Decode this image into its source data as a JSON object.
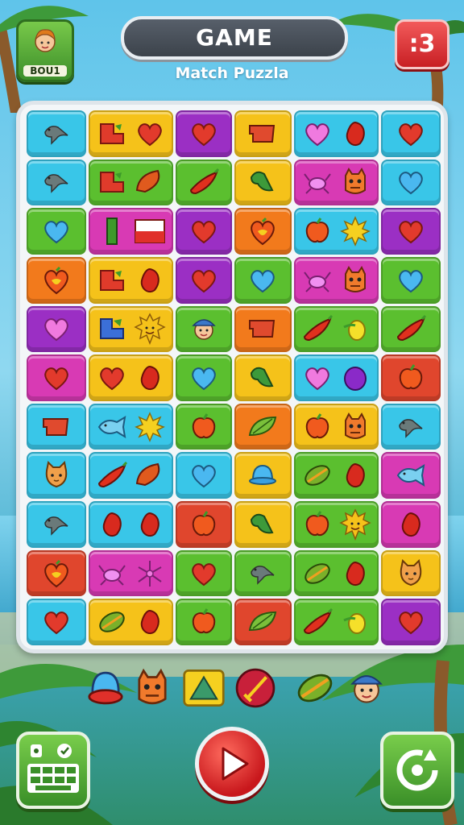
{
  "header": {
    "avatar_label": "BOU1",
    "title": "GAME",
    "subtitle": "Match Puzzla",
    "count_badge": ":3"
  },
  "colors": {
    "cyan": "#39c6e8",
    "yellow": "#f5c21a",
    "purple": "#9b2fc4",
    "orange": "#f27a1c",
    "green": "#5bbf2f",
    "magenta": "#d83ab4",
    "red": "#e0462d"
  },
  "board": {
    "columns": 6,
    "rows": 11,
    "tiles": [
      [
        {
          "c": "cyan",
          "i": [
            "bird"
          ]
        },
        {
          "c": "yellow",
          "i": [
            "block",
            "heart"
          ]
        },
        {
          "c": "purple",
          "i": [
            "heart"
          ]
        },
        {
          "c": "yellow",
          "i": [
            "flag"
          ]
        },
        {
          "c": "cyan",
          "i": [
            "heart-pink",
            "berry"
          ]
        },
        {
          "c": "cyan",
          "i": [
            "heart"
          ]
        }
      ],
      [
        {
          "c": "cyan",
          "i": [
            "bird"
          ]
        },
        {
          "c": "green",
          "i": [
            "block",
            "leaf-red"
          ]
        },
        {
          "c": "green",
          "i": [
            "pepper"
          ]
        },
        {
          "c": "yellow",
          "i": [
            "leaf"
          ]
        },
        {
          "c": "magenta",
          "i": [
            "crab",
            "monster"
          ]
        },
        {
          "c": "cyan",
          "i": [
            "heart-blue"
          ]
        }
      ],
      [
        {
          "c": "green",
          "i": [
            "heart-blue"
          ]
        },
        {
          "c": "magenta",
          "i": [
            "bar",
            "card"
          ]
        },
        {
          "c": "purple",
          "i": [
            "heart"
          ]
        },
        {
          "c": "orange",
          "i": [
            "fruit-heart"
          ]
        },
        {
          "c": "cyan",
          "i": [
            "apple",
            "sun"
          ]
        },
        {
          "c": "purple",
          "i": [
            "heart"
          ]
        }
      ],
      [
        {
          "c": "orange",
          "i": [
            "fruit-heart"
          ]
        },
        {
          "c": "yellow",
          "i": [
            "block",
            "berry"
          ]
        },
        {
          "c": "purple",
          "i": [
            "heart"
          ]
        },
        {
          "c": "green",
          "i": [
            "heart-blue"
          ]
        },
        {
          "c": "magenta",
          "i": [
            "crab",
            "monster"
          ]
        },
        {
          "c": "green",
          "i": [
            "heart-blue"
          ]
        }
      ],
      [
        {
          "c": "purple",
          "i": [
            "heart-pink"
          ]
        },
        {
          "c": "yellow",
          "i": [
            "block-blue",
            "sun-face"
          ]
        },
        {
          "c": "green",
          "i": [
            "boy"
          ]
        },
        {
          "c": "orange",
          "i": [
            "flag"
          ]
        },
        {
          "c": "green",
          "i": [
            "pepper",
            "lemon"
          ]
        },
        {
          "c": "green",
          "i": [
            "pepper"
          ]
        }
      ],
      [
        {
          "c": "magenta",
          "i": [
            "heart"
          ]
        },
        {
          "c": "yellow",
          "i": [
            "heart",
            "berry"
          ]
        },
        {
          "c": "green",
          "i": [
            "heart-blue"
          ]
        },
        {
          "c": "yellow",
          "i": [
            "leaf"
          ]
        },
        {
          "c": "cyan",
          "i": [
            "heart-pink",
            "plum"
          ]
        },
        {
          "c": "red",
          "i": [
            "apple"
          ]
        }
      ],
      [
        {
          "c": "cyan",
          "i": [
            "flag"
          ]
        },
        {
          "c": "cyan",
          "i": [
            "fish",
            "sun"
          ]
        },
        {
          "c": "green",
          "i": [
            "apple"
          ]
        },
        {
          "c": "orange",
          "i": [
            "leaf-green"
          ]
        },
        {
          "c": "yellow",
          "i": [
            "apple",
            "monster"
          ]
        },
        {
          "c": "cyan",
          "i": [
            "bird"
          ]
        }
      ],
      [
        {
          "c": "cyan",
          "i": [
            "cat"
          ]
        },
        {
          "c": "cyan",
          "i": [
            "pepper",
            "leaf-red"
          ]
        },
        {
          "c": "cyan",
          "i": [
            "heart-blue"
          ]
        },
        {
          "c": "yellow",
          "i": [
            "hat"
          ]
        },
        {
          "c": "green",
          "i": [
            "melon",
            "berry"
          ]
        },
        {
          "c": "magenta",
          "i": [
            "fish"
          ]
        }
      ],
      [
        {
          "c": "cyan",
          "i": [
            "bird"
          ]
        },
        {
          "c": "cyan",
          "i": [
            "berry",
            "berry"
          ]
        },
        {
          "c": "red",
          "i": [
            "apple"
          ]
        },
        {
          "c": "yellow",
          "i": [
            "leaf"
          ]
        },
        {
          "c": "green",
          "i": [
            "apple",
            "sun-face"
          ]
        },
        {
          "c": "magenta",
          "i": [
            "berry"
          ]
        }
      ],
      [
        {
          "c": "red",
          "i": [
            "fruit-heart"
          ]
        },
        {
          "c": "magenta",
          "i": [
            "crab",
            "flower"
          ]
        },
        {
          "c": "green",
          "i": [
            "heart"
          ]
        },
        {
          "c": "green",
          "i": [
            "bird"
          ]
        },
        {
          "c": "green",
          "i": [
            "melon",
            "berry"
          ]
        },
        {
          "c": "yellow",
          "i": [
            "cat"
          ]
        }
      ],
      [
        {
          "c": "cyan",
          "i": [
            "heart"
          ]
        },
        {
          "c": "yellow",
          "i": [
            "melon",
            "berry"
          ]
        },
        {
          "c": "green",
          "i": [
            "apple"
          ]
        },
        {
          "c": "red",
          "i": [
            "leaf-green"
          ]
        },
        {
          "c": "green",
          "i": [
            "pepper",
            "lemon"
          ]
        },
        {
          "c": "purple",
          "i": [
            "heart"
          ]
        }
      ]
    ]
  },
  "tray": [
    "hat-red",
    "monster",
    "triangle",
    "sword-ball",
    "melon",
    "boy"
  ],
  "buttons": {
    "left": "keyboard-icon",
    "center": "play-icon",
    "right": "refresh-icon"
  }
}
